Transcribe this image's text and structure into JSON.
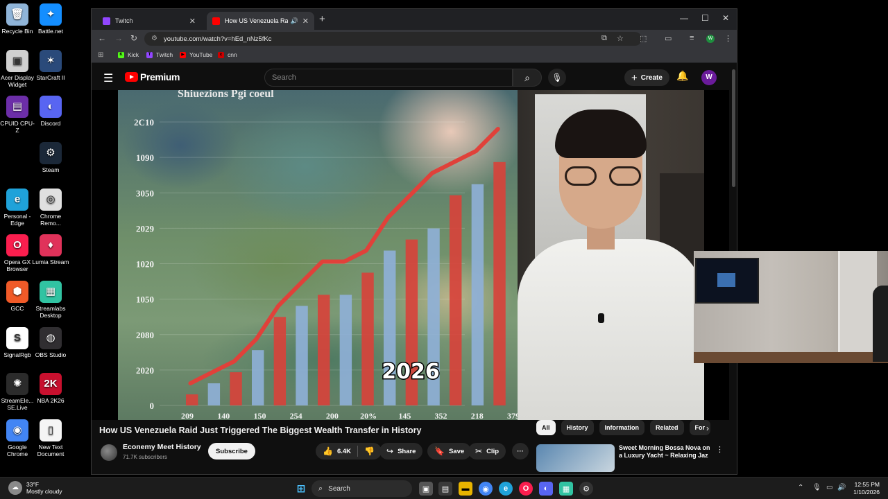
{
  "desktop_icons": [
    {
      "label": "Recycle Bin",
      "icon": "recycle-bin-icon",
      "color": "#8fb4d8"
    },
    {
      "label": "Battle.net",
      "icon": "battlenet-icon",
      "color": "#148eff"
    },
    {
      "label": "Acer Display Widget",
      "icon": "acer-icon",
      "color": "#d0d0d0"
    },
    {
      "label": "StarCraft II",
      "icon": "starcraft-icon",
      "color": "#2a4a7a"
    },
    {
      "label": "CPUID CPU-Z",
      "icon": "cpuz-icon",
      "color": "#6c2ea8"
    },
    {
      "label": "Discord",
      "icon": "discord-icon",
      "color": "#5865f2"
    },
    {
      "label": "Steam",
      "icon": "steam-icon",
      "color": "#1b2838"
    },
    {
      "label": "Personal - Edge",
      "icon": "edge-icon",
      "color": "#1fa2d9"
    },
    {
      "label": "Chrome Remo...",
      "icon": "chrome-remote-icon",
      "color": "#e0e0e0"
    },
    {
      "label": "Opera GX Browser",
      "icon": "opera-gx-icon",
      "color": "#fa1e4e"
    },
    {
      "label": "Lumia Stream",
      "icon": "lumia-icon",
      "color": "#e0325a"
    },
    {
      "label": "GCC",
      "icon": "gcc-icon",
      "color": "#f05a28"
    },
    {
      "label": "Streamlabs Desktop",
      "icon": "streamlabs-icon",
      "color": "#31c3a2"
    },
    {
      "label": "SignalRgb",
      "icon": "signalrgb-icon",
      "color": "#ffffff"
    },
    {
      "label": "OBS Studio",
      "icon": "obs-icon",
      "color": "#302e31"
    },
    {
      "label": "StreamEle... SE.Live",
      "icon": "streamelements-icon",
      "color": "#2b2b2b"
    },
    {
      "label": "NBA 2K26",
      "icon": "nba2k-icon",
      "color": "#c8102e"
    },
    {
      "label": "Google Chrome",
      "icon": "chrome-icon",
      "color": "#4285f4"
    },
    {
      "label": "New Text Document",
      "icon": "text-document-icon",
      "color": "#f5f5f5"
    }
  ],
  "browser": {
    "tabs": [
      {
        "title": "Twitch",
        "favicon_color": "#9146ff",
        "active": false
      },
      {
        "title": "How US Venezuela Raid Just",
        "favicon_color": "#ff0000",
        "active": true
      }
    ],
    "url": "youtube.com/watch?v=hEd_nNz5fKc",
    "bookmarks": [
      {
        "label": "Kick",
        "color": "#53fc18",
        "glyph": "K"
      },
      {
        "label": "Twitch",
        "color": "#9146ff",
        "glyph": "T"
      },
      {
        "label": "YouTube",
        "color": "#ff0000",
        "glyph": "▶"
      },
      {
        "label": "cnn",
        "color": "#cc0000",
        "glyph": "c"
      }
    ],
    "profile_initial": "W"
  },
  "youtube": {
    "brand": "Premium",
    "search_placeholder": "Search",
    "create_label": "Create",
    "avatar_initial": "W",
    "video_title": "How US Venezuela Raid Just Triggered The Biggest Wealth Transfer in History",
    "channel_name": "Econemy Meet History",
    "subscribers": "71.7K subscribers",
    "subscribe_label": "Subscribe",
    "likes": "6.4K",
    "share_label": "Share",
    "save_label": "Save",
    "clip_label": "Clip",
    "more_label": "···",
    "chips": [
      "All",
      "History",
      "Information",
      "Related",
      "For"
    ],
    "recommended": {
      "title": "Sweet Morning Bossa Nova on a Luxury Yacht ~ Relaxing Jaz"
    }
  },
  "chart_data": {
    "type": "bar",
    "title": "Shiuezions Pgi coeul",
    "y_tick_labels": [
      "2C10",
      "1090",
      "3050",
      "2029",
      "1020",
      "1050",
      "2080",
      "2020",
      "0"
    ],
    "x_tick_labels": [
      "209",
      "140",
      "150",
      "254",
      "200",
      "20%",
      "145",
      "352",
      "218",
      "379"
    ],
    "overlay_label": "2026",
    "bar_values": [
      1,
      2,
      3,
      5,
      8,
      9,
      10,
      10,
      12,
      14,
      15,
      16,
      19,
      20,
      22
    ],
    "line_values": [
      2,
      3,
      4,
      6,
      9,
      11,
      13,
      13,
      14,
      17,
      19,
      21,
      22,
      23,
      25
    ],
    "ylim": [
      0,
      26
    ],
    "colors": {
      "bar_red": "#d8413a",
      "bar_blue": "#8fb0d8",
      "line": "#e0413a"
    }
  },
  "taskbar": {
    "temperature": "33°F",
    "weather": "Mostly cloudy",
    "search_label": "Search",
    "time": "12:55 PM",
    "date": "1/10/2026"
  }
}
